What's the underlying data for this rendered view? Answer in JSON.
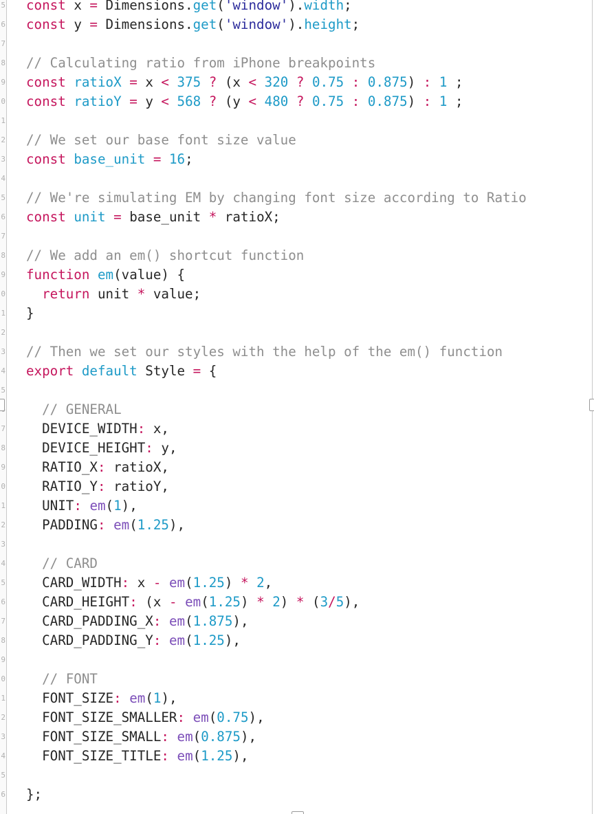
{
  "editor": {
    "gutter_numbers": [
      "5",
      "6",
      "7",
      "8",
      "9",
      "0",
      "1",
      "2",
      "3",
      "4",
      "5",
      "6",
      "7",
      "8",
      "9",
      "0",
      "1",
      "2",
      "3",
      "4",
      "5",
      "6",
      "7",
      "8",
      "9",
      "0",
      "1",
      "2",
      "3",
      "4",
      "5",
      "6",
      "7",
      "8",
      "9",
      "0",
      "1",
      "2",
      "3",
      "4",
      "5",
      "6"
    ],
    "code_lines": [
      {
        "tokens": [
          {
            "t": "const",
            "c": "kw"
          },
          {
            "t": " x ",
            "c": "plain"
          },
          {
            "t": "=",
            "c": "op"
          },
          {
            "t": " Dimensions.",
            "c": "plain"
          },
          {
            "t": "get",
            "c": "fnname"
          },
          {
            "t": "(",
            "c": "plain"
          },
          {
            "t": "'window'",
            "c": "str"
          },
          {
            "t": ").",
            "c": "plain"
          },
          {
            "t": "width",
            "c": "fnname"
          },
          {
            "t": ";",
            "c": "plain"
          }
        ]
      },
      {
        "tokens": [
          {
            "t": "const",
            "c": "kw"
          },
          {
            "t": " y ",
            "c": "plain"
          },
          {
            "t": "=",
            "c": "op"
          },
          {
            "t": " Dimensions.",
            "c": "plain"
          },
          {
            "t": "get",
            "c": "fnname"
          },
          {
            "t": "(",
            "c": "plain"
          },
          {
            "t": "'window'",
            "c": "str"
          },
          {
            "t": ").",
            "c": "plain"
          },
          {
            "t": "height",
            "c": "fnname"
          },
          {
            "t": ";",
            "c": "plain"
          }
        ]
      },
      {
        "tokens": []
      },
      {
        "tokens": [
          {
            "t": "// Calculating ratio from iPhone breakpoints",
            "c": "comment"
          }
        ]
      },
      {
        "tokens": [
          {
            "t": "const",
            "c": "kw"
          },
          {
            "t": " ",
            "c": "plain"
          },
          {
            "t": "ratioX",
            "c": "def"
          },
          {
            "t": " ",
            "c": "plain"
          },
          {
            "t": "=",
            "c": "op"
          },
          {
            "t": " x ",
            "c": "plain"
          },
          {
            "t": "<",
            "c": "op"
          },
          {
            "t": " ",
            "c": "plain"
          },
          {
            "t": "375",
            "c": "num"
          },
          {
            "t": " ",
            "c": "plain"
          },
          {
            "t": "?",
            "c": "op"
          },
          {
            "t": " (x ",
            "c": "plain"
          },
          {
            "t": "<",
            "c": "op"
          },
          {
            "t": " ",
            "c": "plain"
          },
          {
            "t": "320",
            "c": "num"
          },
          {
            "t": " ",
            "c": "plain"
          },
          {
            "t": "?",
            "c": "op"
          },
          {
            "t": " ",
            "c": "plain"
          },
          {
            "t": "0.75",
            "c": "num"
          },
          {
            "t": " ",
            "c": "plain"
          },
          {
            "t": ":",
            "c": "op"
          },
          {
            "t": " ",
            "c": "plain"
          },
          {
            "t": "0.875",
            "c": "num"
          },
          {
            "t": ") ",
            "c": "plain"
          },
          {
            "t": ":",
            "c": "op"
          },
          {
            "t": " ",
            "c": "plain"
          },
          {
            "t": "1",
            "c": "num"
          },
          {
            "t": " ;",
            "c": "plain"
          }
        ]
      },
      {
        "tokens": [
          {
            "t": "const",
            "c": "kw"
          },
          {
            "t": " ",
            "c": "plain"
          },
          {
            "t": "ratioY",
            "c": "def"
          },
          {
            "t": " ",
            "c": "plain"
          },
          {
            "t": "=",
            "c": "op"
          },
          {
            "t": " y ",
            "c": "plain"
          },
          {
            "t": "<",
            "c": "op"
          },
          {
            "t": " ",
            "c": "plain"
          },
          {
            "t": "568",
            "c": "num"
          },
          {
            "t": " ",
            "c": "plain"
          },
          {
            "t": "?",
            "c": "op"
          },
          {
            "t": " (y ",
            "c": "plain"
          },
          {
            "t": "<",
            "c": "op"
          },
          {
            "t": " ",
            "c": "plain"
          },
          {
            "t": "480",
            "c": "num"
          },
          {
            "t": " ",
            "c": "plain"
          },
          {
            "t": "?",
            "c": "op"
          },
          {
            "t": " ",
            "c": "plain"
          },
          {
            "t": "0.75",
            "c": "num"
          },
          {
            "t": " ",
            "c": "plain"
          },
          {
            "t": ":",
            "c": "op"
          },
          {
            "t": " ",
            "c": "plain"
          },
          {
            "t": "0.875",
            "c": "num"
          },
          {
            "t": ") ",
            "c": "plain"
          },
          {
            "t": ":",
            "c": "op"
          },
          {
            "t": " ",
            "c": "plain"
          },
          {
            "t": "1",
            "c": "num"
          },
          {
            "t": " ;",
            "c": "plain"
          }
        ]
      },
      {
        "tokens": []
      },
      {
        "tokens": [
          {
            "t": "// We set our base font size value",
            "c": "comment"
          }
        ]
      },
      {
        "tokens": [
          {
            "t": "const",
            "c": "kw"
          },
          {
            "t": " ",
            "c": "plain"
          },
          {
            "t": "base_unit",
            "c": "def"
          },
          {
            "t": " ",
            "c": "plain"
          },
          {
            "t": "=",
            "c": "op"
          },
          {
            "t": " ",
            "c": "plain"
          },
          {
            "t": "16",
            "c": "num"
          },
          {
            "t": ";",
            "c": "plain"
          }
        ]
      },
      {
        "tokens": []
      },
      {
        "tokens": [
          {
            "t": "// We're simulating EM by changing font size according to Ratio",
            "c": "comment"
          }
        ]
      },
      {
        "tokens": [
          {
            "t": "const",
            "c": "kw"
          },
          {
            "t": " ",
            "c": "plain"
          },
          {
            "t": "unit",
            "c": "def"
          },
          {
            "t": " ",
            "c": "plain"
          },
          {
            "t": "=",
            "c": "op"
          },
          {
            "t": " base_unit ",
            "c": "plain"
          },
          {
            "t": "*",
            "c": "op"
          },
          {
            "t": " ratioX;",
            "c": "plain"
          }
        ]
      },
      {
        "tokens": []
      },
      {
        "tokens": [
          {
            "t": "// We add an em() shortcut function",
            "c": "comment"
          }
        ]
      },
      {
        "tokens": [
          {
            "t": "function",
            "c": "kw"
          },
          {
            "t": " ",
            "c": "plain"
          },
          {
            "t": "em",
            "c": "def"
          },
          {
            "t": "(value) {",
            "c": "plain"
          }
        ]
      },
      {
        "tokens": [
          {
            "t": "  ",
            "c": "plain"
          },
          {
            "t": "return",
            "c": "kw"
          },
          {
            "t": " unit ",
            "c": "plain"
          },
          {
            "t": "*",
            "c": "op"
          },
          {
            "t": " value;",
            "c": "plain"
          }
        ]
      },
      {
        "tokens": [
          {
            "t": "}",
            "c": "plain"
          }
        ]
      },
      {
        "tokens": []
      },
      {
        "tokens": [
          {
            "t": "// Then we set our styles with the help of the em() function",
            "c": "comment"
          }
        ]
      },
      {
        "tokens": [
          {
            "t": "export",
            "c": "kw"
          },
          {
            "t": " ",
            "c": "plain"
          },
          {
            "t": "default",
            "c": "def"
          },
          {
            "t": " Style ",
            "c": "plain"
          },
          {
            "t": "=",
            "c": "op"
          },
          {
            "t": " {",
            "c": "plain"
          }
        ]
      },
      {
        "tokens": []
      },
      {
        "tokens": [
          {
            "t": "  // GENERAL",
            "c": "comment"
          }
        ]
      },
      {
        "tokens": [
          {
            "t": "  DEVICE_WIDTH",
            "c": "plain"
          },
          {
            "t": ":",
            "c": "op"
          },
          {
            "t": " x,",
            "c": "plain"
          }
        ]
      },
      {
        "tokens": [
          {
            "t": "  DEVICE_HEIGHT",
            "c": "plain"
          },
          {
            "t": ":",
            "c": "op"
          },
          {
            "t": " y,",
            "c": "plain"
          }
        ]
      },
      {
        "tokens": [
          {
            "t": "  RATIO_X",
            "c": "plain"
          },
          {
            "t": ":",
            "c": "op"
          },
          {
            "t": " ratioX,",
            "c": "plain"
          }
        ]
      },
      {
        "tokens": [
          {
            "t": "  RATIO_Y",
            "c": "plain"
          },
          {
            "t": ":",
            "c": "op"
          },
          {
            "t": " ratioY,",
            "c": "plain"
          }
        ]
      },
      {
        "tokens": [
          {
            "t": "  UNIT",
            "c": "plain"
          },
          {
            "t": ":",
            "c": "op"
          },
          {
            "t": " ",
            "c": "plain"
          },
          {
            "t": "em",
            "c": "fn"
          },
          {
            "t": "(",
            "c": "plain"
          },
          {
            "t": "1",
            "c": "num"
          },
          {
            "t": "),",
            "c": "plain"
          }
        ]
      },
      {
        "tokens": [
          {
            "t": "  PADDING",
            "c": "plain"
          },
          {
            "t": ":",
            "c": "op"
          },
          {
            "t": " ",
            "c": "plain"
          },
          {
            "t": "em",
            "c": "fn"
          },
          {
            "t": "(",
            "c": "plain"
          },
          {
            "t": "1.25",
            "c": "num"
          },
          {
            "t": "),",
            "c": "plain"
          }
        ]
      },
      {
        "tokens": []
      },
      {
        "tokens": [
          {
            "t": "  // CARD",
            "c": "comment"
          }
        ]
      },
      {
        "tokens": [
          {
            "t": "  CARD_WIDTH",
            "c": "plain"
          },
          {
            "t": ":",
            "c": "op"
          },
          {
            "t": " x ",
            "c": "plain"
          },
          {
            "t": "-",
            "c": "op"
          },
          {
            "t": " ",
            "c": "plain"
          },
          {
            "t": "em",
            "c": "fn"
          },
          {
            "t": "(",
            "c": "plain"
          },
          {
            "t": "1.25",
            "c": "num"
          },
          {
            "t": ") ",
            "c": "plain"
          },
          {
            "t": "*",
            "c": "op"
          },
          {
            "t": " ",
            "c": "plain"
          },
          {
            "t": "2",
            "c": "num"
          },
          {
            "t": ",",
            "c": "plain"
          }
        ]
      },
      {
        "tokens": [
          {
            "t": "  CARD_HEIGHT",
            "c": "plain"
          },
          {
            "t": ":",
            "c": "op"
          },
          {
            "t": " (x ",
            "c": "plain"
          },
          {
            "t": "-",
            "c": "op"
          },
          {
            "t": " ",
            "c": "plain"
          },
          {
            "t": "em",
            "c": "fn"
          },
          {
            "t": "(",
            "c": "plain"
          },
          {
            "t": "1.25",
            "c": "num"
          },
          {
            "t": ") ",
            "c": "plain"
          },
          {
            "t": "*",
            "c": "op"
          },
          {
            "t": " ",
            "c": "plain"
          },
          {
            "t": "2",
            "c": "num"
          },
          {
            "t": ") ",
            "c": "plain"
          },
          {
            "t": "*",
            "c": "op"
          },
          {
            "t": " (",
            "c": "plain"
          },
          {
            "t": "3",
            "c": "num"
          },
          {
            "t": "/",
            "c": "op"
          },
          {
            "t": "5",
            "c": "num"
          },
          {
            "t": "),",
            "c": "plain"
          }
        ]
      },
      {
        "tokens": [
          {
            "t": "  CARD_PADDING_X",
            "c": "plain"
          },
          {
            "t": ":",
            "c": "op"
          },
          {
            "t": " ",
            "c": "plain"
          },
          {
            "t": "em",
            "c": "fn"
          },
          {
            "t": "(",
            "c": "plain"
          },
          {
            "t": "1.875",
            "c": "num"
          },
          {
            "t": "),",
            "c": "plain"
          }
        ]
      },
      {
        "tokens": [
          {
            "t": "  CARD_PADDING_Y",
            "c": "plain"
          },
          {
            "t": ":",
            "c": "op"
          },
          {
            "t": " ",
            "c": "plain"
          },
          {
            "t": "em",
            "c": "fn"
          },
          {
            "t": "(",
            "c": "plain"
          },
          {
            "t": "1.25",
            "c": "num"
          },
          {
            "t": "),",
            "c": "plain"
          }
        ]
      },
      {
        "tokens": []
      },
      {
        "tokens": [
          {
            "t": "  // FONT",
            "c": "comment"
          }
        ]
      },
      {
        "tokens": [
          {
            "t": "  FONT_SIZE",
            "c": "plain"
          },
          {
            "t": ":",
            "c": "op"
          },
          {
            "t": " ",
            "c": "plain"
          },
          {
            "t": "em",
            "c": "fn"
          },
          {
            "t": "(",
            "c": "plain"
          },
          {
            "t": "1",
            "c": "num"
          },
          {
            "t": "),",
            "c": "plain"
          }
        ]
      },
      {
        "tokens": [
          {
            "t": "  FONT_SIZE_SMALLER",
            "c": "plain"
          },
          {
            "t": ":",
            "c": "op"
          },
          {
            "t": " ",
            "c": "plain"
          },
          {
            "t": "em",
            "c": "fn"
          },
          {
            "t": "(",
            "c": "plain"
          },
          {
            "t": "0.75",
            "c": "num"
          },
          {
            "t": "),",
            "c": "plain"
          }
        ]
      },
      {
        "tokens": [
          {
            "t": "  FONT_SIZE_SMALL",
            "c": "plain"
          },
          {
            "t": ":",
            "c": "op"
          },
          {
            "t": " ",
            "c": "plain"
          },
          {
            "t": "em",
            "c": "fn"
          },
          {
            "t": "(",
            "c": "plain"
          },
          {
            "t": "0.875",
            "c": "num"
          },
          {
            "t": "),",
            "c": "plain"
          }
        ]
      },
      {
        "tokens": [
          {
            "t": "  FONT_SIZE_TITLE",
            "c": "plain"
          },
          {
            "t": ":",
            "c": "op"
          },
          {
            "t": " ",
            "c": "plain"
          },
          {
            "t": "em",
            "c": "fn"
          },
          {
            "t": "(",
            "c": "plain"
          },
          {
            "t": "1.25",
            "c": "num"
          },
          {
            "t": "),",
            "c": "plain"
          }
        ]
      },
      {
        "tokens": []
      },
      {
        "tokens": [
          {
            "t": "};",
            "c": "plain"
          }
        ]
      }
    ]
  }
}
